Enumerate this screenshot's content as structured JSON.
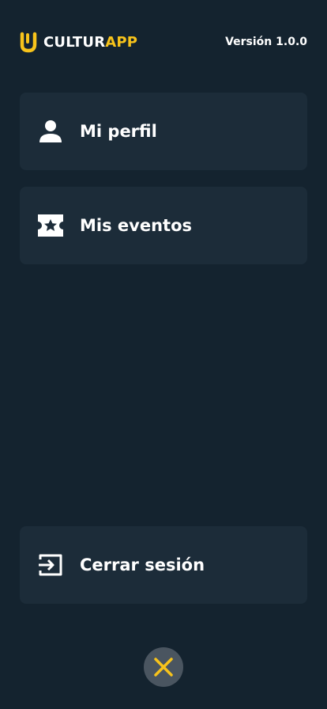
{
  "header": {
    "brand_part_a": "CULTUR",
    "brand_part_b": "APP",
    "version": "Versión 1.0.0"
  },
  "menu": {
    "items": [
      {
        "label": "Mi perfil",
        "icon": "user-icon"
      },
      {
        "label": "Mis eventos",
        "icon": "ticket-star-icon"
      }
    ],
    "logout": {
      "label": "Cerrar sesión",
      "icon": "logout-icon"
    }
  },
  "close_button": {
    "icon": "close-icon"
  },
  "colors": {
    "background": "#14232f",
    "card": "#1c2c39",
    "accent": "#f7c31b",
    "close_button_bg": "#4a5560"
  }
}
